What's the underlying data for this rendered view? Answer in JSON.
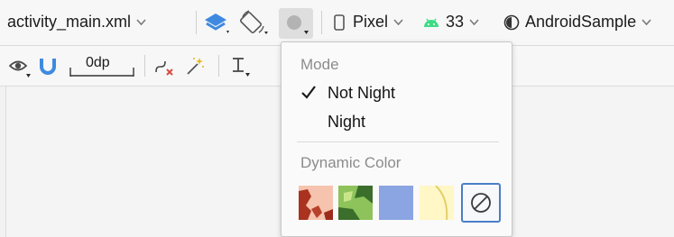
{
  "toolbar": {
    "file_name": "activity_main.xml",
    "device": "Pixel",
    "api_level": "33",
    "theme": "AndroidSample",
    "margin_value": "0dp"
  },
  "menu": {
    "mode_header": "Mode",
    "option_not_night": "Not Night",
    "option_night": "Night",
    "dynamic_color_header": "Dynamic Color",
    "selected_mode": "Not Night",
    "swatches": [
      "red-wallpaper",
      "green-wallpaper",
      "blue",
      "yellow",
      "none"
    ],
    "selected_swatch": "none"
  },
  "colors": {
    "accent": "#4a7ec7",
    "blue_swatch": "#8aa5e2",
    "yellow_swatch": "#fff7c6",
    "android_green": "#3ddc84",
    "layers_blue": "#3f8ae0"
  }
}
